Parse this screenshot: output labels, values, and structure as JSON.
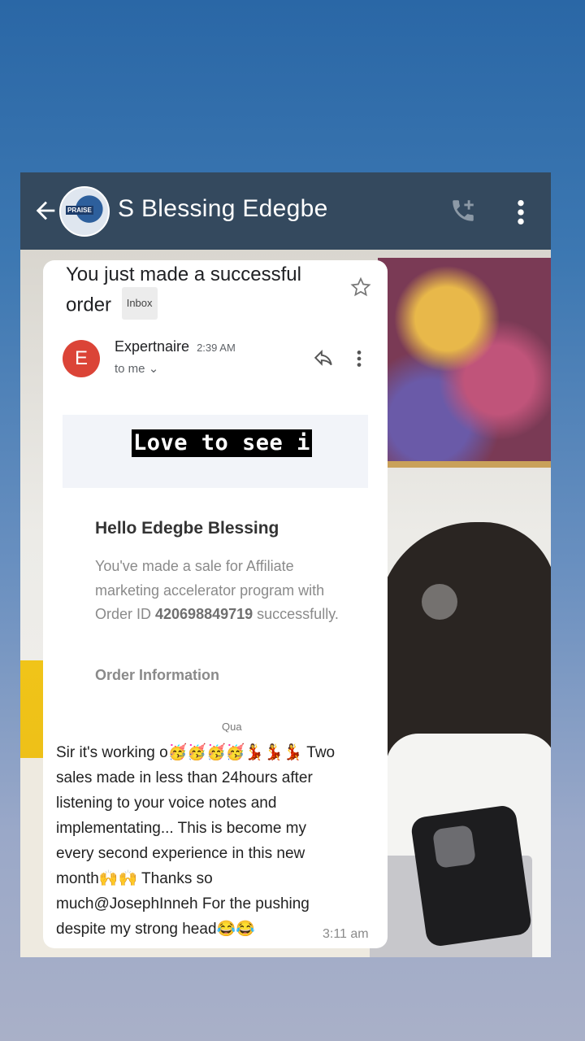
{
  "header": {
    "contact_name": "S Blessing Edegbe",
    "avatar_text": "PRAISE"
  },
  "email": {
    "subject": "You just made a successful order",
    "inbox_label": "Inbox",
    "sender_initial": "E",
    "sender_name": "Expertnaire",
    "sender_time": "2:39 AM",
    "to_label": "to me",
    "greeting": "Hello Edegbe Blessing",
    "body_prefix": "You've made a sale for Affiliate marketing accelerator program with Order ID ",
    "order_id": "420698849719",
    "body_suffix": " successfully.",
    "order_info_label": "Order Information",
    "cut_text": "Qua"
  },
  "overlay_caption": "Love to see i",
  "chat": {
    "message": "Sir it's working o🥳🥳🥳🥳💃💃💃 Two sales made in less than 24hours after listening to your voice notes and implementating... This is become my every second experience in this new month🙌🙌 Thanks so much@JosephInneh For the pushing despite my strong head😂😂",
    "time": "3:11 am"
  },
  "colors": {
    "topbar": "#34495e",
    "sender_avatar": "#db4437"
  }
}
